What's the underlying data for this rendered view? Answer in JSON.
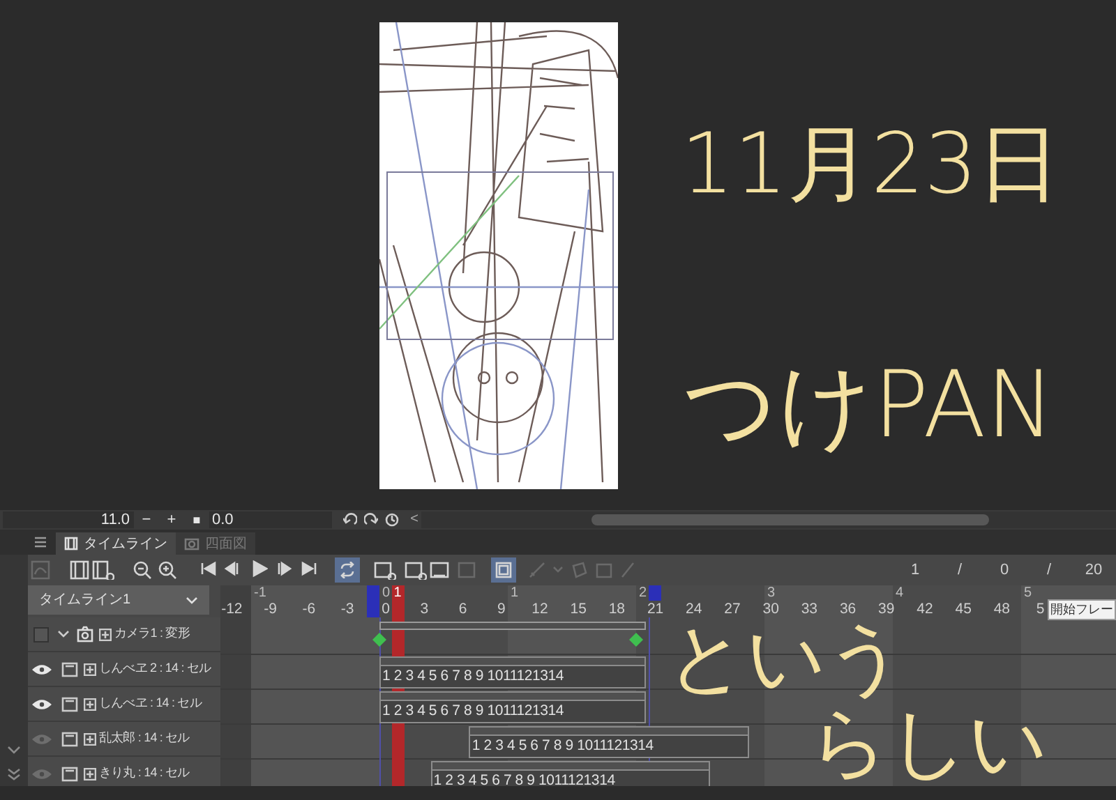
{
  "view_bar": {
    "zoom_value": "11.0",
    "zoom_out": "−",
    "zoom_in": "+",
    "fit": "■",
    "rotate_value": "0.0",
    "collapse": "<"
  },
  "panel_tabs": [
    {
      "label": "タイムライン",
      "selected": true
    },
    {
      "label": "四面図",
      "selected": false
    }
  ],
  "toolbar": {
    "loop_on": true,
    "cel_view_on": true,
    "readout": [
      "1",
      "/",
      "0",
      "/",
      "20"
    ]
  },
  "timeline": {
    "name": "タイムライン1",
    "seconds": [
      "-1",
      "0",
      "1",
      "2",
      "3",
      "4",
      "5"
    ],
    "frames": [
      "-12",
      "-9",
      "-6",
      "-3",
      "0",
      "3",
      "6",
      "9",
      "12",
      "15",
      "18",
      "21",
      "24",
      "27",
      "30",
      "33",
      "36",
      "39",
      "42",
      "45",
      "48",
      "5"
    ],
    "current_frame": "1"
  },
  "layers": [
    {
      "kind": "camera",
      "name": "カメラ1 : 変形",
      "checked": false,
      "expanded": true
    },
    {
      "kind": "cel",
      "name": "しんべヱ 2 : 14 : セル",
      "visible": true,
      "cels": "1 2 3 4 5 6 7 8 9 1011121314"
    },
    {
      "kind": "cel",
      "name": "しんべヱ : 14 : セル",
      "visible": true,
      "cels": "1 2 3 4 5 6 7 8 9 1011121314"
    },
    {
      "kind": "cel",
      "name": "乱太郎 : 14 : セル",
      "visible": false,
      "cels": "1 2 3 4 5 6 7 8 9 1011121314"
    },
    {
      "kind": "cel",
      "name": "きり丸 : 14 : セル",
      "visible": false,
      "cels": "1 2 3 4 5 6 7 8 9 1011121314"
    }
  ],
  "tooltip": "開始フレー",
  "handwriting": [
    "11月23日",
    "つけPAN",
    "という",
    "らしい"
  ]
}
